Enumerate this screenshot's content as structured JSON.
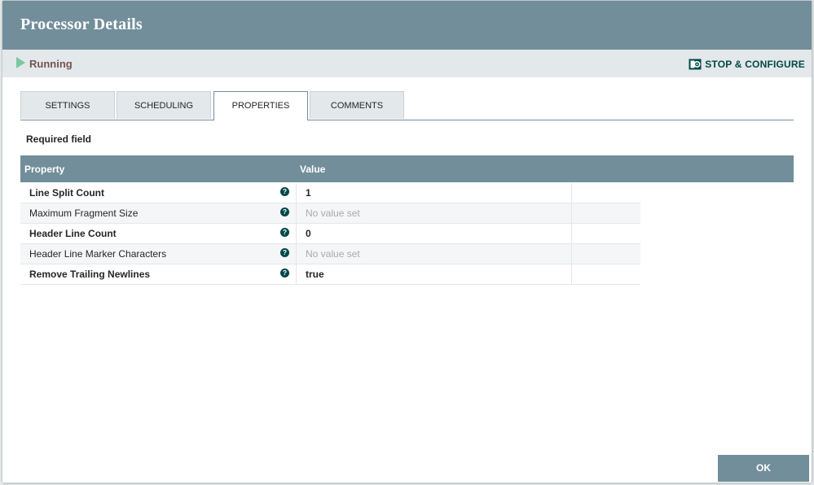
{
  "dialog": {
    "title": "Processor Details",
    "status_label": "Running",
    "stop_configure_label": "STOP & CONFIGURE",
    "ok_label": "OK"
  },
  "tabs": [
    {
      "label": "SETTINGS",
      "active": false
    },
    {
      "label": "SCHEDULING",
      "active": false
    },
    {
      "label": "PROPERTIES",
      "active": true
    },
    {
      "label": "COMMENTS",
      "active": false
    }
  ],
  "properties": {
    "required_label": "Required field",
    "columns": [
      "Property",
      "Value"
    ],
    "rows": [
      {
        "name": "Line Split Count",
        "value": "1",
        "required": true
      },
      {
        "name": "Maximum Fragment Size",
        "value": "No value set",
        "required": false
      },
      {
        "name": "Header Line Count",
        "value": "0",
        "required": true
      },
      {
        "name": "Header Line Marker Characters",
        "value": "No value set",
        "required": false
      },
      {
        "name": "Remove Trailing Newlines",
        "value": "true",
        "required": true
      }
    ]
  },
  "icons": {
    "run": "play-icon",
    "stop_configure": "stop-configure-icon",
    "help": "help-icon"
  },
  "colors": {
    "header": "#728e9b",
    "accent_dark": "#004849",
    "running_green": "#7dc7a0"
  }
}
